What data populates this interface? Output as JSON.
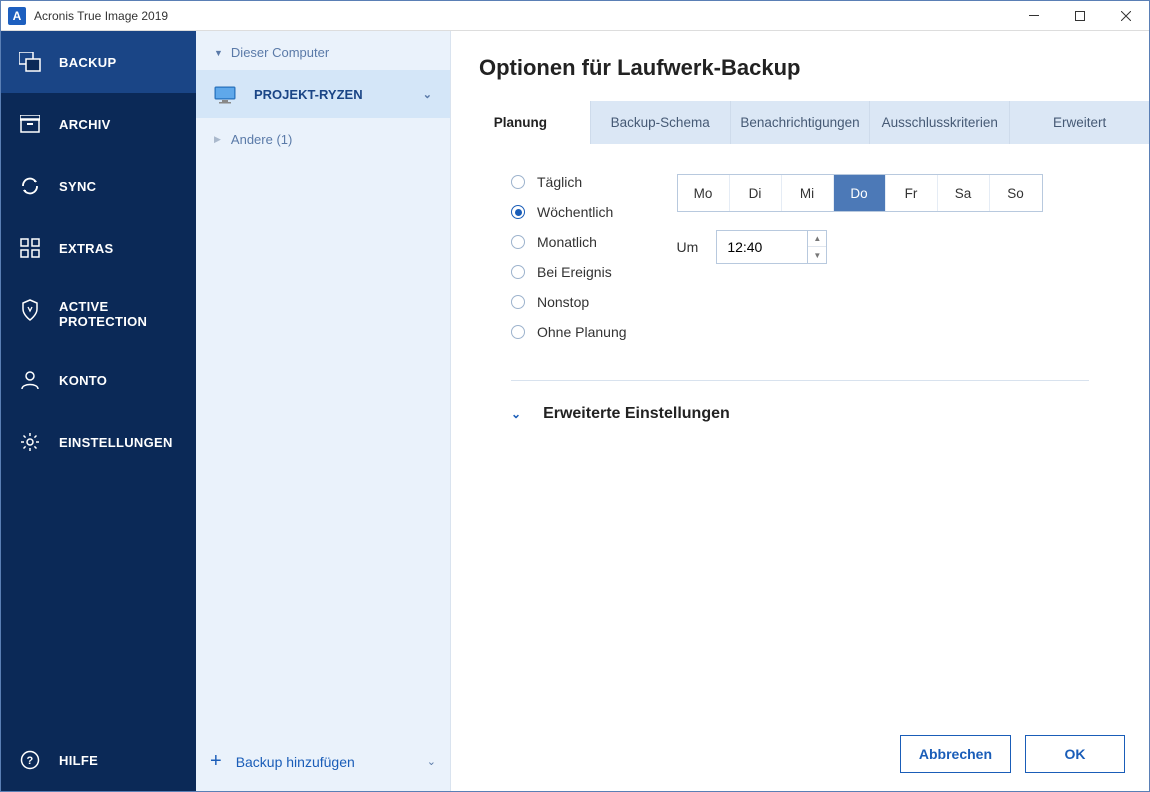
{
  "window": {
    "title": "Acronis True Image 2019",
    "app_letter": "A"
  },
  "nav": {
    "items": [
      {
        "label": "BACKUP",
        "icon": "backup",
        "active": true
      },
      {
        "label": "ARCHIV",
        "icon": "archive"
      },
      {
        "label": "SYNC",
        "icon": "sync"
      },
      {
        "label": "EXTRAS",
        "icon": "extras"
      },
      {
        "label": "ACTIVE\nPROTECTION",
        "icon": "shield"
      },
      {
        "label": "KONTO",
        "icon": "account"
      },
      {
        "label": "EINSTELLUNGEN",
        "icon": "settings"
      }
    ],
    "help": "HILFE"
  },
  "list": {
    "group": "Dieser Computer",
    "selected": "PROJEKT-RYZEN",
    "other": "Andere (1)",
    "add": "Backup hinzufügen"
  },
  "main": {
    "title": "Optionen für Laufwerk-Backup",
    "tabs": [
      "Planung",
      "Backup-Schema",
      "Benachrichtigungen",
      "Ausschlusskriterien",
      "Erweitert"
    ],
    "active_tab": 0,
    "schedule": {
      "options": [
        "Täglich",
        "Wöchentlich",
        "Monatlich",
        "Bei Ereignis",
        "Nonstop",
        "Ohne Planung"
      ],
      "selected": 1,
      "days": [
        "Mo",
        "Di",
        "Mi",
        "Do",
        "Fr",
        "Sa",
        "So"
      ],
      "selected_day": 3,
      "at_label": "Um",
      "time": "12:40"
    },
    "advanced_label": "Erweiterte Einstellungen"
  },
  "footer": {
    "cancel": "Abbrechen",
    "ok": "OK"
  }
}
